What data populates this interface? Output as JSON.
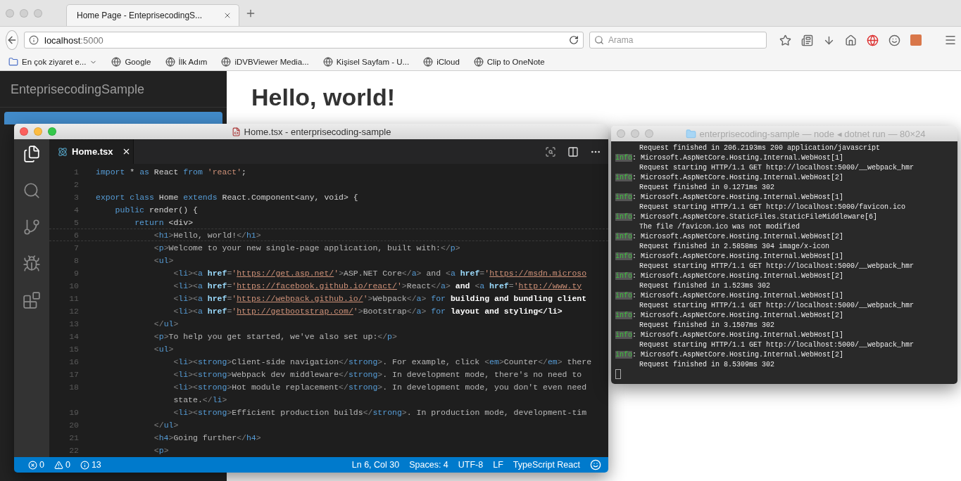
{
  "browser": {
    "tabs": [
      {
        "label": "Home Page - EnteprisecodingS...",
        "selected": true
      }
    ],
    "url": {
      "host": "localhost",
      "port": ":5000"
    },
    "search": {
      "placeholder": "Arama"
    },
    "bookmarks": [
      {
        "label": "En çok ziyaret e...",
        "kind": "folder"
      },
      {
        "label": "Google",
        "kind": "site"
      },
      {
        "label": "İlk Adım",
        "kind": "site"
      },
      {
        "label": "iDVBViewer Media...",
        "kind": "site"
      },
      {
        "label": "Kişisel Sayfam - U...",
        "kind": "site"
      },
      {
        "label": "iCloud",
        "kind": "site"
      },
      {
        "label": "Clip to OneNote",
        "kind": "site"
      }
    ]
  },
  "page": {
    "brand": "EnteprisecodingSample",
    "nav": [
      {
        "selected": true
      }
    ],
    "heading": "Hello, world!"
  },
  "editor": {
    "title": "Home.tsx - enterprisecoding-sample",
    "activity": [
      {
        "kind": "files",
        "selected": true
      },
      {
        "kind": "search",
        "selected": false
      },
      {
        "kind": "git",
        "selected": false
      },
      {
        "kind": "debug",
        "selected": false
      },
      {
        "kind": "extensions",
        "selected": false
      }
    ],
    "tabs": [
      {
        "label": "Home.tsx",
        "selected": true
      }
    ],
    "lines": [
      {
        "kind": "line",
        "n": "1",
        "current": false,
        "segs": [
          {
            "kind": "keyword",
            "text": "import"
          },
          {
            "kind": "plain",
            "text": " * "
          },
          {
            "kind": "keyword",
            "text": "as"
          },
          {
            "kind": "plain",
            "text": " React "
          },
          {
            "kind": "keyword",
            "text": "from"
          },
          {
            "kind": "string",
            "text": " 'react'"
          },
          {
            "kind": "plain",
            "text": ";"
          }
        ]
      },
      {
        "kind": "line",
        "n": "2",
        "current": false
      },
      {
        "kind": "line",
        "n": "3",
        "current": false,
        "segs": [
          {
            "kind": "keyword",
            "text": "export"
          },
          {
            "kind": "keyword",
            "text": " class"
          },
          {
            "kind": "plain",
            "text": " Home "
          },
          {
            "kind": "keyword",
            "text": "extends"
          },
          {
            "kind": "plain",
            "text": " React.Component<any, void> {"
          }
        ]
      },
      {
        "kind": "line",
        "n": "4",
        "current": false,
        "segs": [
          {
            "kind": "keyword",
            "text": "    public"
          },
          {
            "kind": "plain",
            "text": " render() {"
          }
        ]
      },
      {
        "kind": "line",
        "n": "5",
        "current": false,
        "segs": [
          {
            "kind": "keyword",
            "text": "        return"
          },
          {
            "kind": "plain",
            "text": " <div>"
          }
        ]
      },
      {
        "kind": "line",
        "n": "6",
        "current": true,
        "segs": [
          {
            "kind": "punct",
            "text": "            <"
          },
          {
            "kind": "tag",
            "text": "h1"
          },
          {
            "kind": "punct",
            "text": ">"
          },
          {
            "kind": "text",
            "text": "Hello, world!"
          },
          {
            "kind": "punct",
            "text": "</"
          },
          {
            "kind": "tag",
            "text": "h1"
          },
          {
            "kind": "punct",
            "text": ">"
          }
        ]
      },
      {
        "kind": "line",
        "n": "7",
        "current": false,
        "segs": [
          {
            "kind": "punct",
            "text": "            <"
          },
          {
            "kind": "tag",
            "text": "p"
          },
          {
            "kind": "punct",
            "text": ">"
          },
          {
            "kind": "text",
            "text": "Welcome to your new single-page application, built with:"
          },
          {
            "kind": "punct",
            "text": "</"
          },
          {
            "kind": "tag",
            "text": "p"
          },
          {
            "kind": "punct",
            "text": ">"
          }
        ]
      },
      {
        "kind": "line",
        "n": "8",
        "current": false,
        "segs": [
          {
            "kind": "punct",
            "text": "            <"
          },
          {
            "kind": "tag",
            "text": "ul"
          },
          {
            "kind": "punct",
            "text": ">"
          }
        ]
      },
      {
        "kind": "line",
        "n": "9",
        "current": false,
        "segs": [
          {
            "kind": "punct",
            "text": "                <"
          },
          {
            "kind": "tag",
            "text": "li"
          },
          {
            "kind": "punct",
            "text": "><"
          },
          {
            "kind": "tag",
            "text": "a"
          },
          {
            "kind": "attr",
            "text": " href"
          },
          {
            "kind": "punct",
            "text": "="
          },
          {
            "kind": "string",
            "text": "'"
          },
          {
            "kind": "link",
            "text": "https://get.asp.net/"
          },
          {
            "kind": "string",
            "text": "'"
          },
          {
            "kind": "punct",
            "text": ">"
          },
          {
            "kind": "text",
            "text": "ASP.NET Core"
          },
          {
            "kind": "punct",
            "text": "</"
          },
          {
            "kind": "tag",
            "text": "a"
          },
          {
            "kind": "punct",
            "text": ">"
          },
          {
            "kind": "text",
            "text": " and "
          },
          {
            "kind": "punct",
            "text": "<"
          },
          {
            "kind": "tag",
            "text": "a"
          },
          {
            "kind": "attr",
            "text": " href"
          },
          {
            "kind": "punct",
            "text": "="
          },
          {
            "kind": "string",
            "text": "'"
          },
          {
            "kind": "link",
            "text": "https://msdn.microso"
          }
        ]
      },
      {
        "kind": "line",
        "n": "10",
        "current": false,
        "segs": [
          {
            "kind": "punct",
            "text": "                <"
          },
          {
            "kind": "tag",
            "text": "li"
          },
          {
            "kind": "punct",
            "text": "><"
          },
          {
            "kind": "tag",
            "text": "a"
          },
          {
            "kind": "attr",
            "text": " href"
          },
          {
            "kind": "punct",
            "text": "="
          },
          {
            "kind": "string",
            "text": "'"
          },
          {
            "kind": "link",
            "text": "https://facebook.github.io/react/"
          },
          {
            "kind": "string",
            "text": "'"
          },
          {
            "kind": "punct",
            "text": ">"
          },
          {
            "kind": "text",
            "text": "React"
          },
          {
            "kind": "punct",
            "text": "</"
          },
          {
            "kind": "tag",
            "text": "a"
          },
          {
            "kind": "punct",
            "text": ">"
          },
          {
            "kind": "bold",
            "text": " and "
          },
          {
            "kind": "punct",
            "text": "<"
          },
          {
            "kind": "tag",
            "text": "a"
          },
          {
            "kind": "attr",
            "text": " href"
          },
          {
            "kind": "punct",
            "text": "="
          },
          {
            "kind": "string",
            "text": "'"
          },
          {
            "kind": "link",
            "text": "http://www.ty"
          }
        ]
      },
      {
        "kind": "line",
        "n": "11",
        "current": false,
        "segs": [
          {
            "kind": "punct",
            "text": "                <"
          },
          {
            "kind": "tag",
            "text": "li"
          },
          {
            "kind": "punct",
            "text": "><"
          },
          {
            "kind": "tag",
            "text": "a"
          },
          {
            "kind": "attr",
            "text": " href"
          },
          {
            "kind": "punct",
            "text": "="
          },
          {
            "kind": "string",
            "text": "'"
          },
          {
            "kind": "link",
            "text": "https://webpack.github.io/"
          },
          {
            "kind": "string",
            "text": "'"
          },
          {
            "kind": "punct",
            "text": ">"
          },
          {
            "kind": "text",
            "text": "Webpack"
          },
          {
            "kind": "punct",
            "text": "</"
          },
          {
            "kind": "tag",
            "text": "a"
          },
          {
            "kind": "punct",
            "text": ">"
          },
          {
            "kind": "keyword",
            "text": " for"
          },
          {
            "kind": "bold",
            "text": " building and bundling client"
          }
        ]
      },
      {
        "kind": "line",
        "n": "12",
        "current": false,
        "segs": [
          {
            "kind": "punct",
            "text": "                <"
          },
          {
            "kind": "tag",
            "text": "li"
          },
          {
            "kind": "punct",
            "text": "><"
          },
          {
            "kind": "tag",
            "text": "a"
          },
          {
            "kind": "attr",
            "text": " href"
          },
          {
            "kind": "punct",
            "text": "="
          },
          {
            "kind": "string",
            "text": "'"
          },
          {
            "kind": "link",
            "text": "http://getbootstrap.com/"
          },
          {
            "kind": "string",
            "text": "'"
          },
          {
            "kind": "punct",
            "text": ">"
          },
          {
            "kind": "text",
            "text": "Bootstrap"
          },
          {
            "kind": "punct",
            "text": "</"
          },
          {
            "kind": "tag",
            "text": "a"
          },
          {
            "kind": "punct",
            "text": ">"
          },
          {
            "kind": "keyword",
            "text": " for"
          },
          {
            "kind": "bold",
            "text": " layout and styling</li>"
          }
        ]
      },
      {
        "kind": "line",
        "n": "13",
        "current": false,
        "segs": [
          {
            "kind": "punct",
            "text": "            </"
          },
          {
            "kind": "tag",
            "text": "ul"
          },
          {
            "kind": "punct",
            "text": ">"
          }
        ]
      },
      {
        "kind": "line",
        "n": "14",
        "current": false,
        "segs": [
          {
            "kind": "punct",
            "text": "            <"
          },
          {
            "kind": "tag",
            "text": "p"
          },
          {
            "kind": "punct",
            "text": ">"
          },
          {
            "kind": "text",
            "text": "To help you get started, we've also set up:"
          },
          {
            "kind": "punct",
            "text": "</"
          },
          {
            "kind": "tag",
            "text": "p"
          },
          {
            "kind": "punct",
            "text": ">"
          }
        ]
      },
      {
        "kind": "line",
        "n": "15",
        "current": false,
        "segs": [
          {
            "kind": "punct",
            "text": "            <"
          },
          {
            "kind": "tag",
            "text": "ul"
          },
          {
            "kind": "punct",
            "text": ">"
          }
        ]
      },
      {
        "kind": "line",
        "n": "16",
        "current": false,
        "segs": [
          {
            "kind": "punct",
            "text": "                <"
          },
          {
            "kind": "tag",
            "text": "li"
          },
          {
            "kind": "punct",
            "text": "><"
          },
          {
            "kind": "tag",
            "text": "strong"
          },
          {
            "kind": "punct",
            "text": ">"
          },
          {
            "kind": "text",
            "text": "Client-side navigation"
          },
          {
            "kind": "punct",
            "text": "</"
          },
          {
            "kind": "tag",
            "text": "strong"
          },
          {
            "kind": "punct",
            "text": ">"
          },
          {
            "kind": "text",
            "text": ". For example, click "
          },
          {
            "kind": "punct",
            "text": "<"
          },
          {
            "kind": "tag",
            "text": "em"
          },
          {
            "kind": "punct",
            "text": ">"
          },
          {
            "kind": "text",
            "text": "Counter"
          },
          {
            "kind": "punct",
            "text": "</"
          },
          {
            "kind": "tag",
            "text": "em"
          },
          {
            "kind": "punct",
            "text": ">"
          },
          {
            "kind": "text",
            "text": " there"
          }
        ]
      },
      {
        "kind": "line",
        "n": "17",
        "current": false,
        "segs": [
          {
            "kind": "punct",
            "text": "                <"
          },
          {
            "kind": "tag",
            "text": "li"
          },
          {
            "kind": "punct",
            "text": "><"
          },
          {
            "kind": "tag",
            "text": "strong"
          },
          {
            "kind": "punct",
            "text": ">"
          },
          {
            "kind": "text",
            "text": "Webpack dev middleware"
          },
          {
            "kind": "punct",
            "text": "</"
          },
          {
            "kind": "tag",
            "text": "strong"
          },
          {
            "kind": "punct",
            "text": ">"
          },
          {
            "kind": "text",
            "text": ". In development mode, there's no need to"
          }
        ]
      },
      {
        "kind": "line",
        "n": "18",
        "current": false,
        "segs": [
          {
            "kind": "punct",
            "text": "                <"
          },
          {
            "kind": "tag",
            "text": "li"
          },
          {
            "kind": "punct",
            "text": "><"
          },
          {
            "kind": "tag",
            "text": "strong"
          },
          {
            "kind": "punct",
            "text": ">"
          },
          {
            "kind": "text",
            "text": "Hot module replacement"
          },
          {
            "kind": "punct",
            "text": "</"
          },
          {
            "kind": "tag",
            "text": "strong"
          },
          {
            "kind": "punct",
            "text": ">"
          },
          {
            "kind": "text",
            "text": ". In development mode, you don't even need"
          }
        ]
      },
      {
        "kind": "wrap",
        "current": false,
        "segs": [
          {
            "kind": "text",
            "text": "                state."
          },
          {
            "kind": "punct",
            "text": "</"
          },
          {
            "kind": "tag",
            "text": "li"
          },
          {
            "kind": "punct",
            "text": ">"
          }
        ]
      },
      {
        "kind": "line",
        "n": "19",
        "current": false,
        "segs": [
          {
            "kind": "punct",
            "text": "                <"
          },
          {
            "kind": "tag",
            "text": "li"
          },
          {
            "kind": "punct",
            "text": "><"
          },
          {
            "kind": "tag",
            "text": "strong"
          },
          {
            "kind": "punct",
            "text": ">"
          },
          {
            "kind": "text",
            "text": "Efficient production builds"
          },
          {
            "kind": "punct",
            "text": "</"
          },
          {
            "kind": "tag",
            "text": "strong"
          },
          {
            "kind": "punct",
            "text": ">"
          },
          {
            "kind": "text",
            "text": ". In production mode, development-tim"
          }
        ]
      },
      {
        "kind": "line",
        "n": "20",
        "current": false,
        "segs": [
          {
            "kind": "punct",
            "text": "            </"
          },
          {
            "kind": "tag",
            "text": "ul"
          },
          {
            "kind": "punct",
            "text": ">"
          }
        ]
      },
      {
        "kind": "line",
        "n": "21",
        "current": false,
        "segs": [
          {
            "kind": "punct",
            "text": "            <"
          },
          {
            "kind": "tag",
            "text": "h4"
          },
          {
            "kind": "punct",
            "text": ">"
          },
          {
            "kind": "text",
            "text": "Going further"
          },
          {
            "kind": "punct",
            "text": "</"
          },
          {
            "kind": "tag",
            "text": "h4"
          },
          {
            "kind": "punct",
            "text": ">"
          }
        ]
      },
      {
        "kind": "line",
        "n": "22",
        "current": false,
        "segs": [
          {
            "kind": "punct",
            "text": "            <"
          },
          {
            "kind": "tag",
            "text": "p"
          },
          {
            "kind": "punct",
            "text": ">"
          }
        ]
      }
    ],
    "status": {
      "errors": "0",
      "warnings": "0",
      "infos": "13",
      "items": [
        "Ln 6, Col 30",
        "Spaces: 4",
        "UTF-8",
        "LF",
        "TypeScript React"
      ]
    }
  },
  "terminal": {
    "title": "enterprisecoding-sample — node ◂ dotnet run — 80×24",
    "lines": [
      {
        "kind": "msg",
        "text": "Request finished in 206.2193ms 200 application/javascript"
      },
      {
        "kind": "info",
        "tag": "info",
        "text": ": Microsoft.AspNetCore.Hosting.Internal.WebHost[1]"
      },
      {
        "kind": "msg",
        "text": "Request starting HTTP/1.1 GET http://localhost:5000/__webpack_hmr"
      },
      {
        "kind": "info",
        "tag": "info",
        "text": ": Microsoft.AspNetCore.Hosting.Internal.WebHost[2]"
      },
      {
        "kind": "msg",
        "text": "Request finished in 0.1271ms 302"
      },
      {
        "kind": "info",
        "tag": "info",
        "text": ": Microsoft.AspNetCore.Hosting.Internal.WebHost[1]"
      },
      {
        "kind": "msg",
        "text": "Request starting HTTP/1.1 GET http://localhost:5000/favicon.ico"
      },
      {
        "kind": "info",
        "tag": "info",
        "text": ": Microsoft.AspNetCore.StaticFiles.StaticFileMiddleware[6]"
      },
      {
        "kind": "msg",
        "text": "The file /favicon.ico was not modified"
      },
      {
        "kind": "info",
        "tag": "info",
        "text": ": Microsoft.AspNetCore.Hosting.Internal.WebHost[2]"
      },
      {
        "kind": "msg",
        "text": "Request finished in 2.5858ms 304 image/x-icon"
      },
      {
        "kind": "info",
        "tag": "info",
        "text": ": Microsoft.AspNetCore.Hosting.Internal.WebHost[1]"
      },
      {
        "kind": "msg",
        "text": "Request starting HTTP/1.1 GET http://localhost:5000/__webpack_hmr"
      },
      {
        "kind": "info",
        "tag": "info",
        "text": ": Microsoft.AspNetCore.Hosting.Internal.WebHost[2]"
      },
      {
        "kind": "msg",
        "text": "Request finished in 1.523ms 302"
      },
      {
        "kind": "info",
        "tag": "info",
        "text": ": Microsoft.AspNetCore.Hosting.Internal.WebHost[1]"
      },
      {
        "kind": "msg",
        "text": "Request starting HTTP/1.1 GET http://localhost:5000/__webpack_hmr"
      },
      {
        "kind": "info",
        "tag": "info",
        "text": ": Microsoft.AspNetCore.Hosting.Internal.WebHost[2]"
      },
      {
        "kind": "msg",
        "text": "Request finished in 3.1507ms 302"
      },
      {
        "kind": "info",
        "tag": "info",
        "text": ": Microsoft.AspNetCore.Hosting.Internal.WebHost[1]"
      },
      {
        "kind": "msg",
        "text": "Request starting HTTP/1.1 GET http://localhost:5000/__webpack_hmr"
      },
      {
        "kind": "info",
        "tag": "info",
        "text": ": Microsoft.AspNetCore.Hosting.Internal.WebHost[2]"
      },
      {
        "kind": "msg",
        "text": "Request finished in 8.5309ms 302"
      },
      {
        "kind": "cursor"
      }
    ]
  }
}
